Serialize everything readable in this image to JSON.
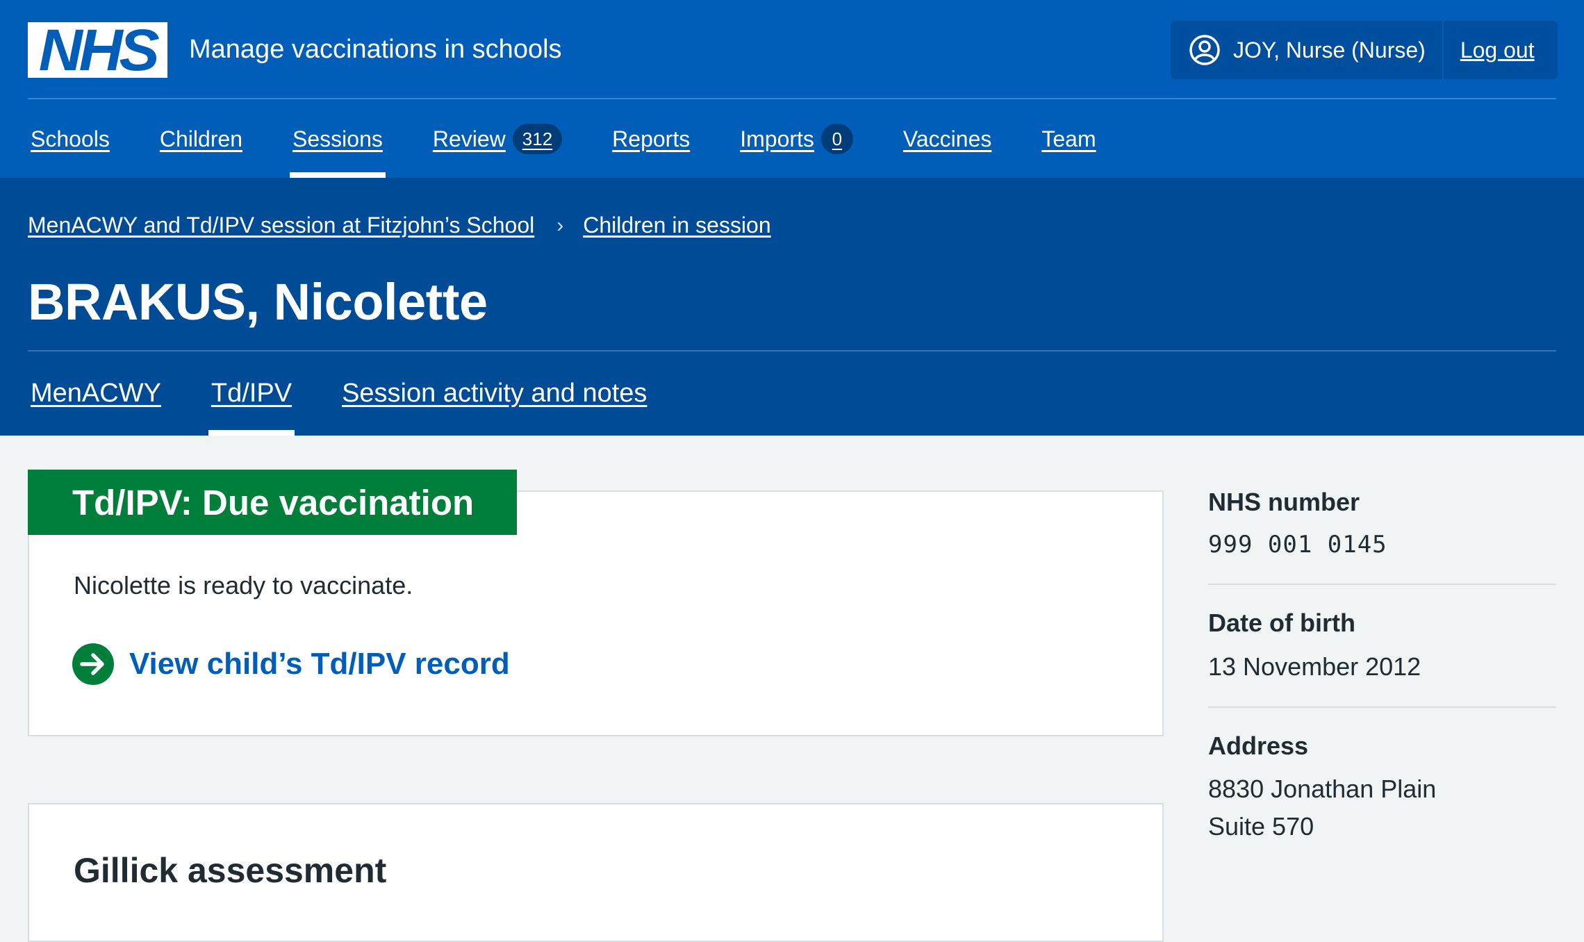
{
  "header": {
    "logo_text": "NHS",
    "service_name": "Manage vaccinations in schools",
    "user_label": "JOY, Nurse (Nurse)",
    "logout_label": "Log out",
    "nav": [
      {
        "label": "Schools"
      },
      {
        "label": "Children"
      },
      {
        "label": "Sessions",
        "active": true
      },
      {
        "label": "Review",
        "count": "312"
      },
      {
        "label": "Reports"
      },
      {
        "label": "Imports",
        "count": "0"
      },
      {
        "label": "Vaccines"
      },
      {
        "label": "Team"
      }
    ]
  },
  "breadcrumb": [
    {
      "label": "MenACWY and Td/IPV session at Fitzjohn’s School"
    },
    {
      "label": "Children in session"
    }
  ],
  "page_title": "BRAKUS, Nicolette",
  "tabs": [
    {
      "label": "MenACWY"
    },
    {
      "label": "Td/IPV",
      "active": true
    },
    {
      "label": "Session activity and notes"
    }
  ],
  "status_card": {
    "heading": "Td/IPV: Due vaccination",
    "text": "Nicolette is ready to vaccinate.",
    "link_label": "View child’s Td/IPV record",
    "color": "#007f3b"
  },
  "gillick_card": {
    "title": "Gillick assessment"
  },
  "summary": {
    "nhs_number_label": "NHS number",
    "nhs_number": "999 001 0145",
    "dob_label": "Date of birth",
    "dob": "13 November 2012",
    "address_label": "Address",
    "address_line1": "8830 Jonathan Plain",
    "address_line2": "Suite 570"
  },
  "colors": {
    "header_blue": "#005eb8",
    "band_blue": "#004b96",
    "status_green": "#007f3b",
    "link_blue": "#005eb8"
  }
}
